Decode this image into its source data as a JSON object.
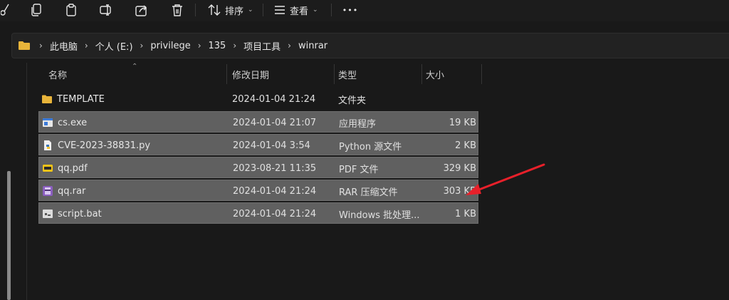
{
  "toolbar": {
    "sort_label": "排序",
    "view_label": "查看",
    "more_label": "•••"
  },
  "address": {
    "crumbs": [
      "此电脑",
      "个人 (E:)",
      "privilege",
      "135",
      "项目工具",
      "winrar"
    ]
  },
  "columns": {
    "name": "名称",
    "date": "修改日期",
    "type": "类型",
    "size": "大小"
  },
  "files": [
    {
      "name": "TEMPLATE",
      "date": "2024-01-04 21:24",
      "type": "文件夹",
      "size": "",
      "icon": "folder-icon",
      "selected": false
    },
    {
      "name": "cs.exe",
      "date": "2024-01-04 21:07",
      "type": "应用程序",
      "size": "19 KB",
      "icon": "exe-icon",
      "selected": true
    },
    {
      "name": "CVE-2023-38831.py",
      "date": "2024-01-04 3:54",
      "type": "Python 源文件",
      "size": "2 KB",
      "icon": "python-file-icon",
      "selected": true
    },
    {
      "name": "qq.pdf",
      "date": "2023-08-21 11:35",
      "type": "PDF 文件",
      "size": "329 KB",
      "icon": "pdf-icon",
      "selected": true
    },
    {
      "name": "qq.rar",
      "date": "2024-01-04 21:24",
      "type": "RAR 压缩文件",
      "size": "303 KB",
      "icon": "rar-icon",
      "selected": true
    },
    {
      "name": "script.bat",
      "date": "2024-01-04 21:24",
      "type": "Windows 批处理...",
      "size": "1 KB",
      "icon": "bat-icon",
      "selected": true
    }
  ],
  "colors": {
    "background": "#191919",
    "selection": "#606060",
    "folder": "#e8b43a",
    "annotation_arrow": "#e8202a"
  }
}
